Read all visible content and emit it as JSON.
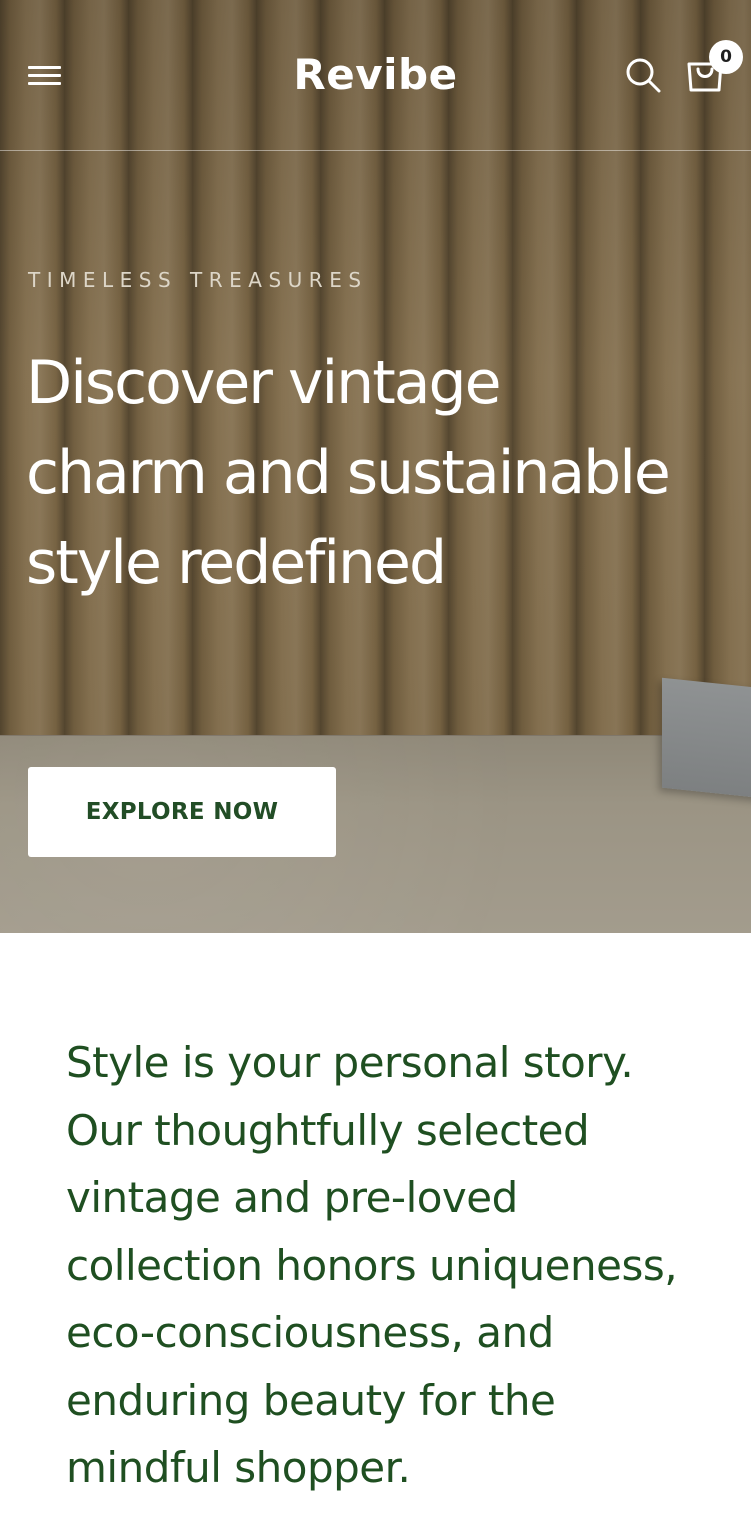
{
  "header": {
    "brand": "Revibe",
    "menu_icon": "hamburger-menu-icon",
    "search_icon": "search-icon",
    "cart_icon": "shopping-bag-icon",
    "cart_count": "0"
  },
  "hero": {
    "eyebrow": "TIMELESS TREASURES",
    "headline": "Discover vintage charm and sustainable style redefined",
    "cta_label": "EXPLORE NOW"
  },
  "intro": {
    "text": "Style is your personal story. Our thoughtfully selected vintage and pre-loved collection honors uniqueness, eco-consciousness, and enduring beauty for the mindful shopper."
  },
  "colors": {
    "text_green": "#1f4f21",
    "button_text": "#224d26",
    "hero_brown": "#7a6543",
    "white": "#ffffff"
  }
}
